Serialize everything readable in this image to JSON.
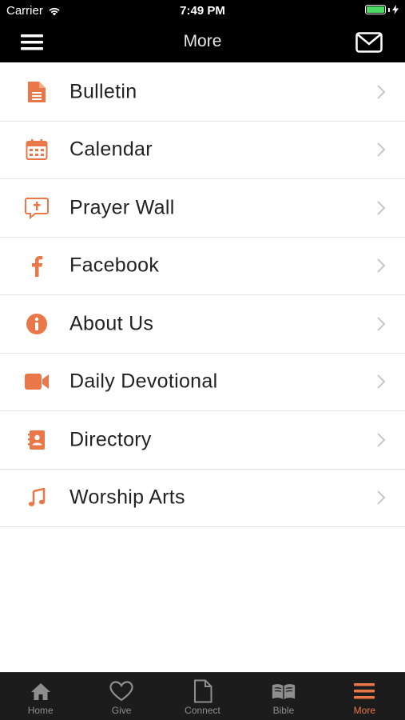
{
  "status_bar": {
    "carrier": "Carrier",
    "time": "7:49 PM"
  },
  "nav": {
    "title": "More"
  },
  "colors": {
    "accent": "#ea7748",
    "bar_bg": "#000000",
    "tab_bg": "#1c1c1c"
  },
  "list": [
    {
      "label": "Bulletin",
      "icon": "document-icon"
    },
    {
      "label": "Calendar",
      "icon": "calendar-icon"
    },
    {
      "label": "Prayer Wall",
      "icon": "prayer-bubble-icon"
    },
    {
      "label": "Facebook",
      "icon": "facebook-icon"
    },
    {
      "label": "About Us",
      "icon": "info-icon"
    },
    {
      "label": "Daily Devotional",
      "icon": "video-camera-icon"
    },
    {
      "label": "Directory",
      "icon": "address-book-icon"
    },
    {
      "label": "Worship Arts",
      "icon": "music-note-icon"
    }
  ],
  "tabs": [
    {
      "label": "Home",
      "icon": "home-icon",
      "active": false
    },
    {
      "label": "Give",
      "icon": "heart-icon",
      "active": false
    },
    {
      "label": "Connect",
      "icon": "page-icon",
      "active": false
    },
    {
      "label": "Bible",
      "icon": "book-icon",
      "active": false
    },
    {
      "label": "More",
      "icon": "hamburger-icon",
      "active": true
    }
  ]
}
